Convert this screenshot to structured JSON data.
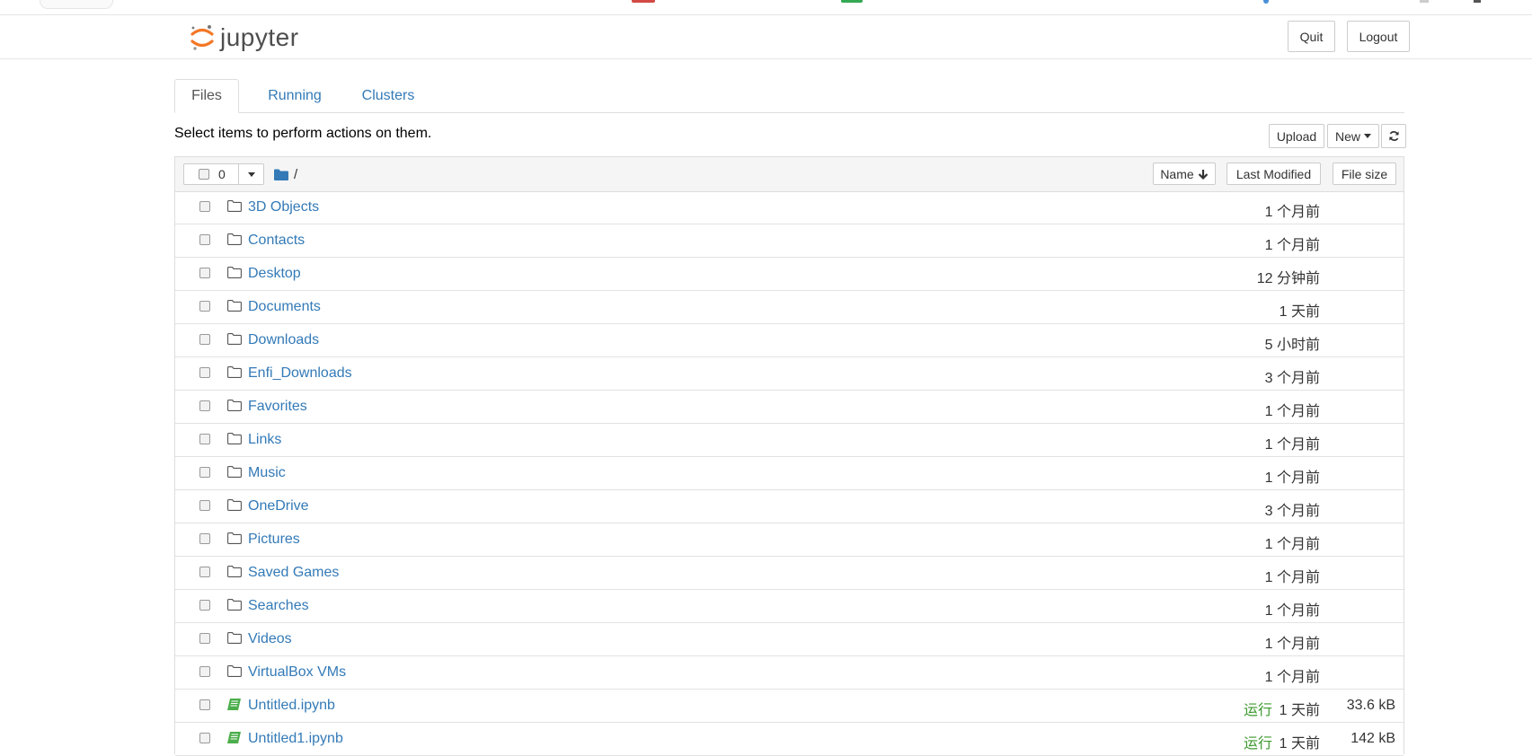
{
  "brand": {
    "name": "jupyter",
    "orange": "#f37726"
  },
  "header": {
    "quit_label": "Quit",
    "logout_label": "Logout"
  },
  "tabs": [
    {
      "label": "Files",
      "active": true
    },
    {
      "label": "Running",
      "active": false
    },
    {
      "label": "Clusters",
      "active": false
    }
  ],
  "toolbar": {
    "hint": "Select items to perform actions on them.",
    "upload_label": "Upload",
    "new_label": "New"
  },
  "list_header": {
    "selected_count": "0",
    "breadcrumb": "/",
    "sort_name": "Name",
    "sort_modified": "Last Modified",
    "sort_size": "File size"
  },
  "items": [
    {
      "type": "folder",
      "name": "3D Objects",
      "modified": "1 个月前",
      "status": "",
      "size": ""
    },
    {
      "type": "folder",
      "name": "Contacts",
      "modified": "1 个月前",
      "status": "",
      "size": ""
    },
    {
      "type": "folder",
      "name": "Desktop",
      "modified": "12 分钟前",
      "status": "",
      "size": ""
    },
    {
      "type": "folder",
      "name": "Documents",
      "modified": "1 天前",
      "status": "",
      "size": ""
    },
    {
      "type": "folder",
      "name": "Downloads",
      "modified": "5 小时前",
      "status": "",
      "size": ""
    },
    {
      "type": "folder",
      "name": "Enfi_Downloads",
      "modified": "3 个月前",
      "status": "",
      "size": ""
    },
    {
      "type": "folder",
      "name": "Favorites",
      "modified": "1 个月前",
      "status": "",
      "size": ""
    },
    {
      "type": "folder",
      "name": "Links",
      "modified": "1 个月前",
      "status": "",
      "size": ""
    },
    {
      "type": "folder",
      "name": "Music",
      "modified": "1 个月前",
      "status": "",
      "size": ""
    },
    {
      "type": "folder",
      "name": "OneDrive",
      "modified": "3 个月前",
      "status": "",
      "size": ""
    },
    {
      "type": "folder",
      "name": "Pictures",
      "modified": "1 个月前",
      "status": "",
      "size": ""
    },
    {
      "type": "folder",
      "name": "Saved Games",
      "modified": "1 个月前",
      "status": "",
      "size": ""
    },
    {
      "type": "folder",
      "name": "Searches",
      "modified": "1 个月前",
      "status": "",
      "size": ""
    },
    {
      "type": "folder",
      "name": "Videos",
      "modified": "1 个月前",
      "status": "",
      "size": ""
    },
    {
      "type": "folder",
      "name": "VirtualBox VMs",
      "modified": "1 个月前",
      "status": "",
      "size": ""
    },
    {
      "type": "notebook",
      "name": "Untitled.ipynb",
      "modified": "1 天前",
      "status": "运行",
      "size": "33.6 kB"
    },
    {
      "type": "notebook",
      "name": "Untitled1.ipynb",
      "modified": "1 天前",
      "status": "运行",
      "size": "142 kB"
    }
  ],
  "colors": {
    "link": "#337ab7",
    "running": "#3c9a2e",
    "notebook_icon": "#4cae4c"
  }
}
